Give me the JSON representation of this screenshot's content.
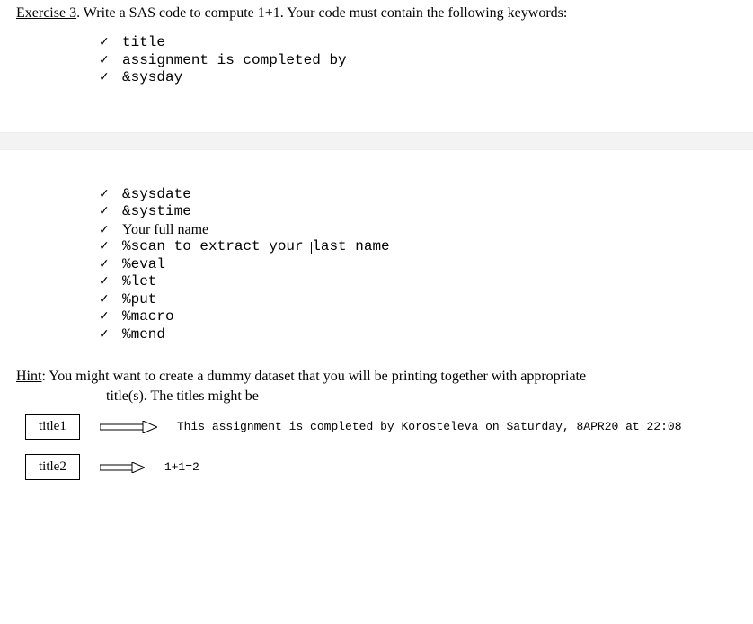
{
  "exercise": {
    "label": "Exercise 3",
    "period": ".",
    "prompt": "  Write a SAS code to compute 1+1. Your code must contain the following keywords:"
  },
  "checklist_top": [
    "title",
    "assignment is completed by",
    "&sysday"
  ],
  "checklist_bottom": [
    {
      "text": "&sysdate",
      "mono": true
    },
    {
      "text": "&systime",
      "mono": true
    },
    {
      "text": "Your full name",
      "mono": false
    },
    {
      "text_pre": "%scan to extract your ",
      "text_post": "last name",
      "mono": true,
      "has_caret": true
    },
    {
      "text": "%eval",
      "mono": true
    },
    {
      "text": "%let",
      "mono": true
    },
    {
      "text": "%put",
      "mono": true
    },
    {
      "text": "%macro",
      "mono": true
    },
    {
      "text": "%mend",
      "mono": true
    }
  ],
  "hint": {
    "label": "Hint",
    "text1": ": You might want to create a dummy dataset that you will be printing together with appropriate",
    "text2": "title(s). The titles might be"
  },
  "titles": [
    {
      "box": "title1",
      "out": "This assignment is completed by Korosteleva on Saturday, 8APR20 at 22:08"
    },
    {
      "box": "title2",
      "out": "1+1=2"
    }
  ],
  "check_glyph": "✓"
}
